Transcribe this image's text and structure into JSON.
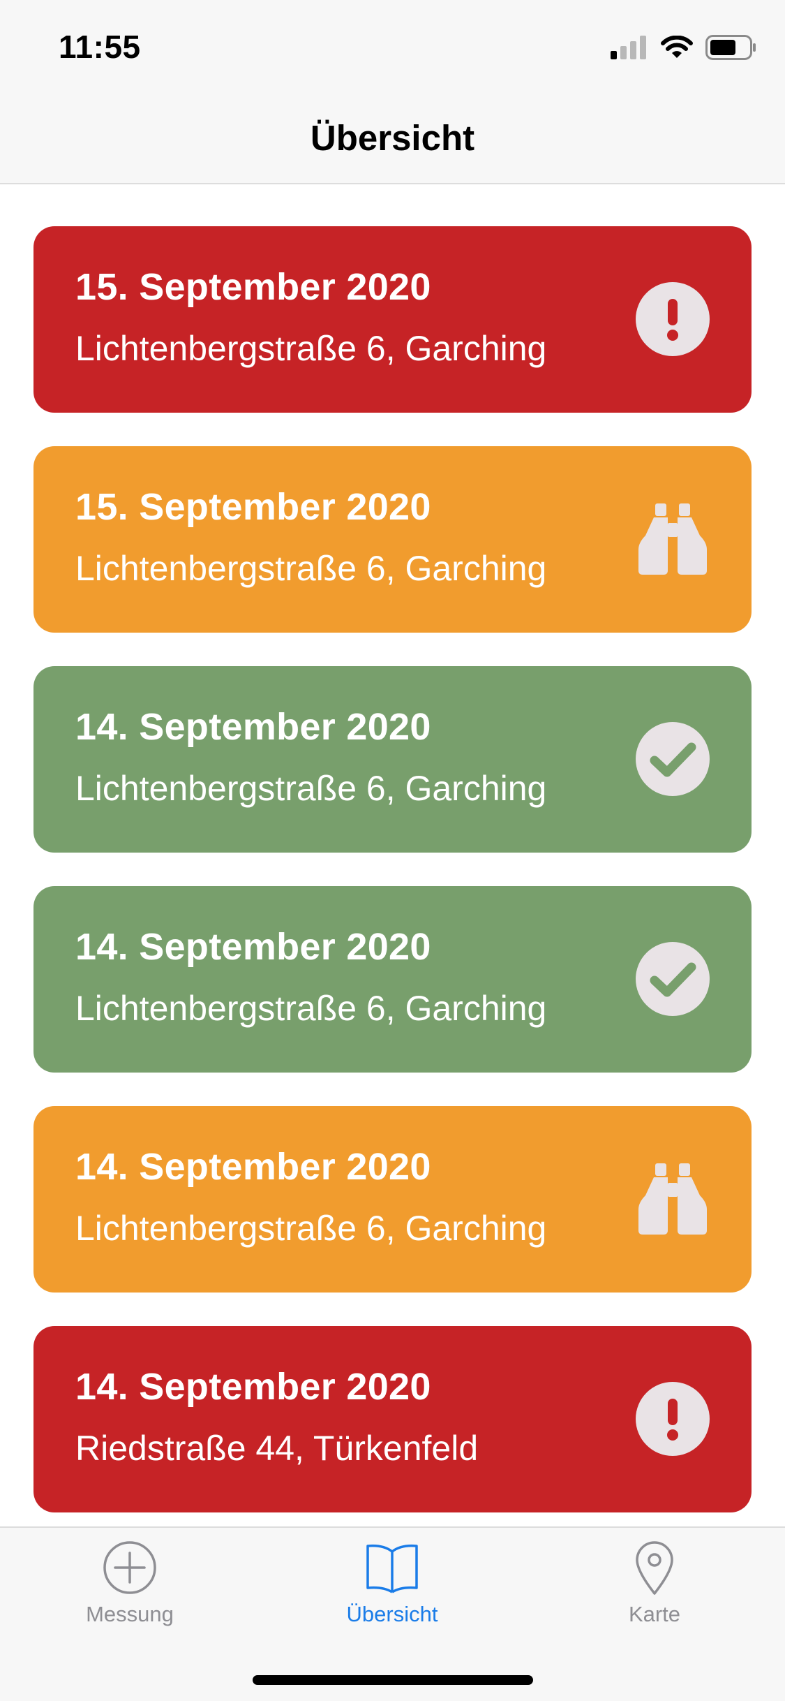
{
  "status_bar": {
    "time": "11:55",
    "icons": [
      "signal-icon",
      "wifi-icon",
      "battery-icon"
    ]
  },
  "nav": {
    "title": "Übersicht"
  },
  "colors": {
    "red": "#c62326",
    "orange": "#f19c2e",
    "green": "#789f6c",
    "tab_active": "#1a7ce8",
    "tab_inactive": "#8e8e93",
    "icon_fill": "#e9e3e6"
  },
  "entries": [
    {
      "date": "15. September 2020",
      "address": "Lichtenbergstraße 6, Garching",
      "status": "red",
      "icon": "exclamation-icon"
    },
    {
      "date": "15. September 2020",
      "address": "Lichtenbergstraße 6, Garching",
      "status": "orange",
      "icon": "binoculars-icon"
    },
    {
      "date": "14. September 2020",
      "address": "Lichtenbergstraße 6, Garching",
      "status": "green",
      "icon": "checkmark-icon"
    },
    {
      "date": "14. September 2020",
      "address": "Lichtenbergstraße 6, Garching",
      "status": "green",
      "icon": "checkmark-icon"
    },
    {
      "date": "14. September 2020",
      "address": "Lichtenbergstraße 6, Garching",
      "status": "orange",
      "icon": "binoculars-icon"
    },
    {
      "date": "14. September 2020",
      "address": "Riedstraße 44, Türkenfeld",
      "status": "red",
      "icon": "exclamation-icon"
    }
  ],
  "tabs": [
    {
      "label": "Messung",
      "icon": "plus-circle-icon",
      "active": false
    },
    {
      "label": "Übersicht",
      "icon": "book-icon",
      "active": true
    },
    {
      "label": "Karte",
      "icon": "map-pin-icon",
      "active": false
    }
  ]
}
